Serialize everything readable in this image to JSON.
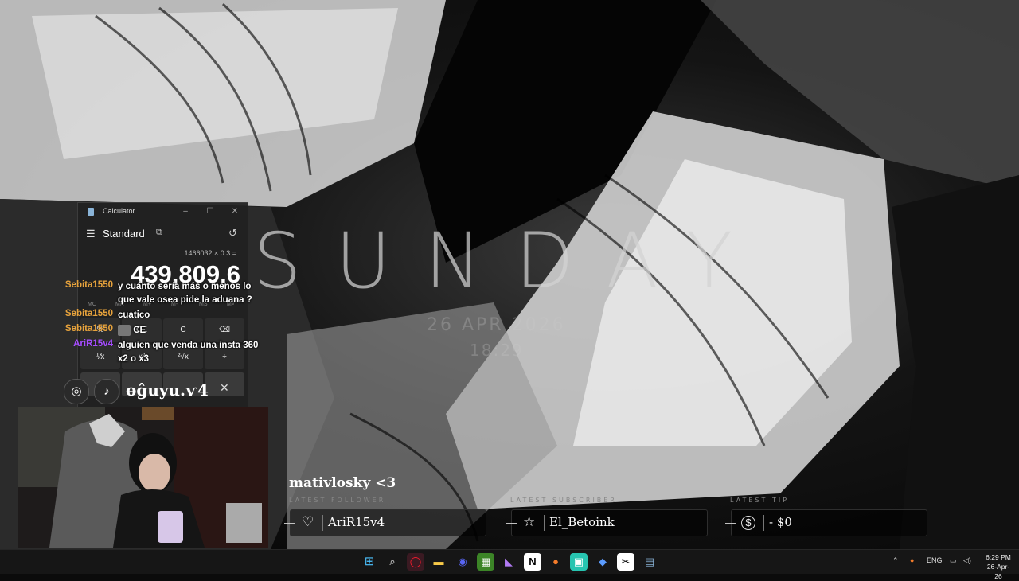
{
  "wallpaper": {
    "headline": "SUNDAY",
    "date": "26 APR 2026",
    "time": "18:29"
  },
  "calculator": {
    "title": "Calculator",
    "mode": "Standard",
    "expression": "1466032 × 0.3 =",
    "display": "439,809.6",
    "memory": [
      "MC",
      "MR",
      "M+",
      "M-",
      "MS",
      "M˅"
    ],
    "keys_row1": [
      "%",
      "CE",
      "C",
      "⌫"
    ],
    "keys_row2": [
      "⅟x",
      "x²",
      "²√x",
      "÷"
    ],
    "window": {
      "minimize": "–",
      "maximize": "☐",
      "close": "✕"
    }
  },
  "chat": [
    {
      "user": "Sebita1550",
      "message": "y cuánto sería más o menos lo que vale osea pide la aduana ?",
      "color": "#e8a33c"
    },
    {
      "user": "Sebita1550",
      "message": "cuatico",
      "color": "#e8a33c"
    },
    {
      "user": "Sebita1550",
      "message": "CE",
      "color": "#e8a33c"
    },
    {
      "user": "AriR15v4",
      "message": "alguien que venda una insta 360 x2 o x3",
      "color": "#a64dff"
    }
  ],
  "social": {
    "handle": "ɵĝuyu.ѵ4",
    "close": "✕",
    "icons": [
      "instagram-icon",
      "tiktok-icon"
    ]
  },
  "stream": {
    "follower_name": "mativlosky <3",
    "latest_follower_label": "LATEST FOLLOWER",
    "latest_subscriber_label": "LATEST SUBSCRIBER",
    "latest_tip_label": "LATEST TIP",
    "latest_follower": "AriR15v4",
    "latest_subscriber": "El_Betoink",
    "latest_tip": "- $0"
  },
  "taskbar": {
    "apps": [
      "start",
      "search",
      "opera-gx",
      "file-explorer",
      "discord",
      "minecraft",
      "visual-studio",
      "notion",
      "mic-app",
      "wallpaper-engine",
      "obs",
      "capcut",
      "calculator"
    ],
    "language": "ENG",
    "time": "6:29 PM",
    "date": "26-Apr-26"
  },
  "colors": {
    "accent": "#e8a33c",
    "purple_user": "#a64dff"
  }
}
